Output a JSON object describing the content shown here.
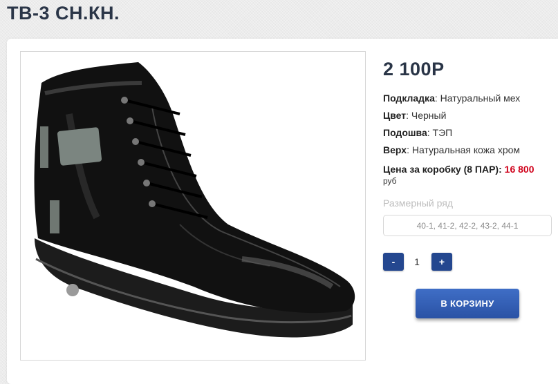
{
  "product": {
    "title": "ТВ-3 СН.КН.",
    "price": "2 100Р",
    "image_icon": "boot-photo",
    "specs": [
      {
        "label": "Подкладка",
        "value": "Натуральный мех"
      },
      {
        "label": "Цвет",
        "value": "Черный"
      },
      {
        "label": "Подошва",
        "value": "ТЭП"
      },
      {
        "label": "Верх",
        "value": "Натуральная кожа хром"
      }
    ],
    "box_price": {
      "label": "Цена за коробку (8 ПАР)",
      "value": "16 800",
      "currency": "руб"
    }
  },
  "size_range": {
    "label": "Размерный ряд",
    "selected": "40-1, 41-2, 42-2, 43-2, 44-1"
  },
  "quantity": {
    "minus_label": "-",
    "value": "1",
    "plus_label": "+"
  },
  "cart_button": {
    "label": "В КОРЗИНУ"
  },
  "colors": {
    "title": "#2a3547",
    "accent_blue": "#24478f",
    "box_price_red": "#d0021b"
  }
}
